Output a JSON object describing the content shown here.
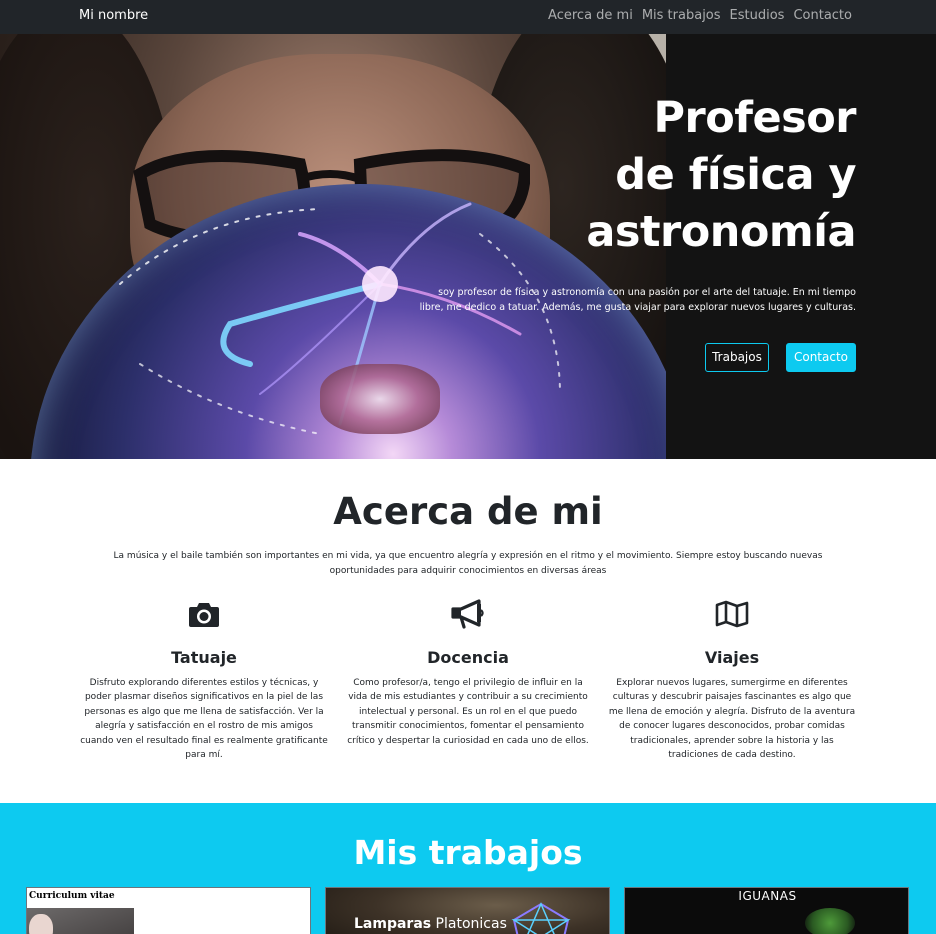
{
  "navbar": {
    "brand": "Mi nombre",
    "links": [
      "Acerca de mi",
      "Mis trabajos",
      "Estudios",
      "Contacto"
    ]
  },
  "hero": {
    "title_lines": [
      "Profesor",
      "de física y",
      "astronomía"
    ],
    "lead": "soy profesor de física y astronomía con una pasión por el arte del tatuaje. En mi tiempo libre, me dedico a tatuar. Además, me gusta viajar para explorar nuevos lugares y culturas.",
    "button_works": "Trabajos",
    "button_contact": "Contacto",
    "image_icon": "photo-portrait-plasma-ball"
  },
  "about": {
    "title": "Acerca de mi",
    "text": "La música y el baile también son importantes en mi vida, ya que encuentro alegría y expresión en el ritmo y el movimiento. Siempre estoy buscando nuevas oportunidades para adquirir conocimientos en diversas áreas",
    "features": [
      {
        "icon": "camera-icon",
        "title": "Tatuaje",
        "text": "Disfruto explorando diferentes estilos y técnicas, y poder plasmar diseños significativos en la piel de las personas es algo que me llena de satisfacción. Ver la alegría y satisfacción en el rostro de mis amigos cuando ven el resultado final es realmente gratificante para mí."
      },
      {
        "icon": "megaphone-icon",
        "title": "Docencia",
        "text": "Como profesor/a, tengo el privilegio de influir en la vida de mis estudiantes y contribuir a su crecimiento intelectual y personal. Es un rol en el que puedo transmitir conocimientos, fomentar el pensamiento crítico y despertar la curiosidad en cada uno de ellos."
      },
      {
        "icon": "map-icon",
        "title": "Viajes",
        "text": "Explorar nuevos lugares, sumergirme en diferentes culturas y descubrir paisajes fascinantes es algo que me llena de emoción y alegría. Disfruto de la aventura de conocer lugares desconocidos, probar comidas tradicionales, aprender sobre la historia y las tradiciones de cada destino."
      }
    ]
  },
  "works": {
    "title": "Mis trabajos",
    "cards": [
      {
        "label": "Curriculum vitae"
      },
      {
        "label_bold": "Lamparas",
        "label_rest": " Platonicas"
      },
      {
        "label": "IGUANAS"
      }
    ]
  },
  "colors": {
    "navbar_bg": "#212529",
    "accent_info": "#0dcaf0",
    "hero_bg": "#131313"
  }
}
